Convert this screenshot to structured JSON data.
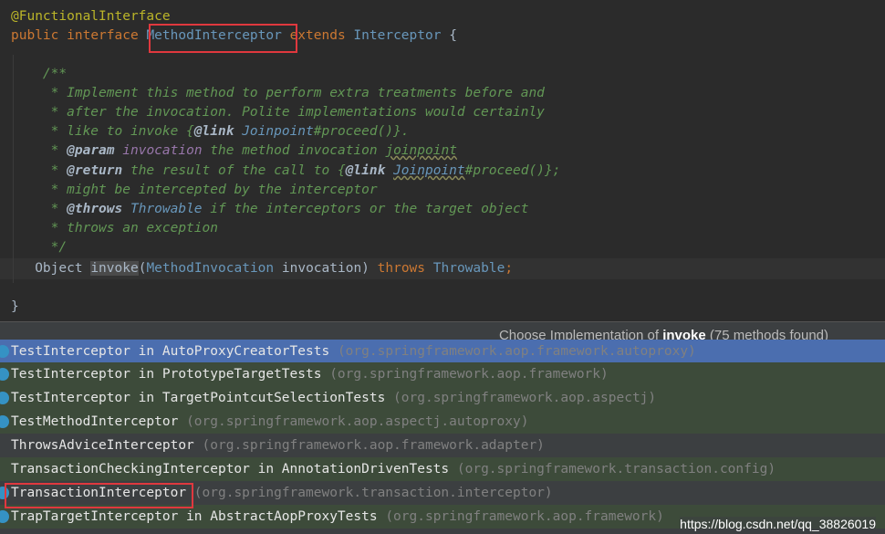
{
  "code": {
    "annotation": "@FunctionalInterface",
    "decl_public": "public",
    "decl_interface": "interface",
    "interface_name": "MethodInterceptor",
    "decl_extends": "extends",
    "super_name": "Interceptor",
    "open_brace": "{",
    "doc_open": "/**",
    "doc_line1": "* Implement this method to perform extra treatments before and",
    "doc_line2": "* after the invocation. Polite implementations would certainly",
    "doc_line3_a": "* like to invoke {",
    "doc_line3_link": "@link",
    "doc_line3_ref": "Joinpoint",
    "doc_line3_b": "#proceed()}.",
    "doc_line4_star": "* ",
    "doc_line4_tag": "@param",
    "doc_line4_param": "invocation",
    "doc_line4_text": "the method invocation ",
    "doc_line4_jp": "joinpoint",
    "doc_line5_star": "* ",
    "doc_line5_tag": "@return",
    "doc_line5_text": "the result of the call to {",
    "doc_line5_link": "@link",
    "doc_line5_ref": "Joinpoint",
    "doc_line5_end": "#proceed()};",
    "doc_line6": "* might be intercepted by the interceptor",
    "doc_line7_star": "* ",
    "doc_line7_tag": "@throws",
    "doc_line7_ref": "Throwable",
    "doc_line7_text": "if the interceptors or the target object",
    "doc_line8": "* throws an exception",
    "doc_close": "*/",
    "method_ret": "Object",
    "method_name": "invoke",
    "method_paren_open": "(",
    "method_param_type": "MethodInvocation",
    "method_param_name": "invocation)",
    "method_throws": "throws",
    "method_throwable": "Throwable",
    "method_semicolon": ";",
    "close_brace": "}"
  },
  "popup": {
    "title_prefix": "Choose Implementation of ",
    "title_method": "invoke",
    "title_suffix": " (75 methods found)",
    "rows": [
      {
        "cls": "TestInterceptor in AutoProxyCreatorTests",
        "pkg": "(org.springframework.aop.framework.autoproxy)"
      },
      {
        "cls": "TestInterceptor in PrototypeTargetTests",
        "pkg": "(org.springframework.aop.framework)"
      },
      {
        "cls": "TestInterceptor in TargetPointcutSelectionTests",
        "pkg": "(org.springframework.aop.aspectj)"
      },
      {
        "cls": "TestMethodInterceptor",
        "pkg": "(org.springframework.aop.aspectj.autoproxy)"
      },
      {
        "cls": "ThrowsAdviceInterceptor",
        "pkg": "(org.springframework.aop.framework.adapter)"
      },
      {
        "cls": "TransactionCheckingInterceptor in AnnotationDrivenTests",
        "pkg": "(org.springframework.transaction.config)"
      },
      {
        "cls": "TransactionInterceptor",
        "pkg": "(org.springframework.transaction.interceptor)"
      },
      {
        "cls": "TrapTargetInterceptor in AbstractAopProxyTests",
        "pkg": "(org.springframework.aop.framework)"
      }
    ]
  },
  "watermark": "https://blog.csdn.net/qq_38826019"
}
